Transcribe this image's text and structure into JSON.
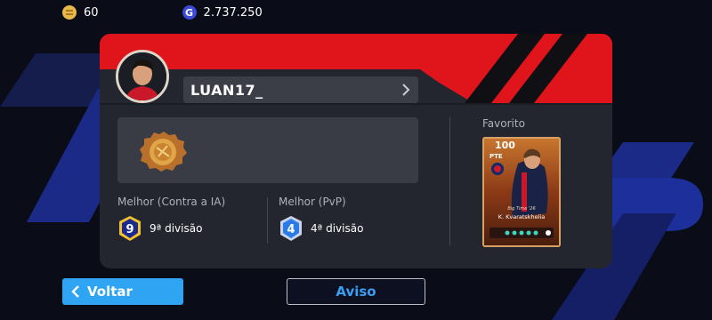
{
  "currencies": {
    "coins": "60",
    "gp": "2.737.250",
    "gp_glyph": "G"
  },
  "profile": {
    "username": "LUAN17_"
  },
  "ranks": {
    "ai": {
      "title": "Melhor (Contra a IA)",
      "level": "9",
      "division": "9ª divisão",
      "badge_color": "#f2c230"
    },
    "pvp": {
      "title": "Melhor (PvP)",
      "level": "4",
      "division": "4ª divisão",
      "badge_color": "#2a7ae8"
    }
  },
  "favorite": {
    "label": "Favorito",
    "rating": "100",
    "position": "PTE",
    "season": "Big Time '26",
    "player_name": "K. Kvaratskhelia"
  },
  "buttons": {
    "back": "Voltar",
    "notice": "Aviso"
  },
  "colors": {
    "accent_red": "#e0151b",
    "accent_blue": "#2ea4f3",
    "panel": "#24262f"
  }
}
